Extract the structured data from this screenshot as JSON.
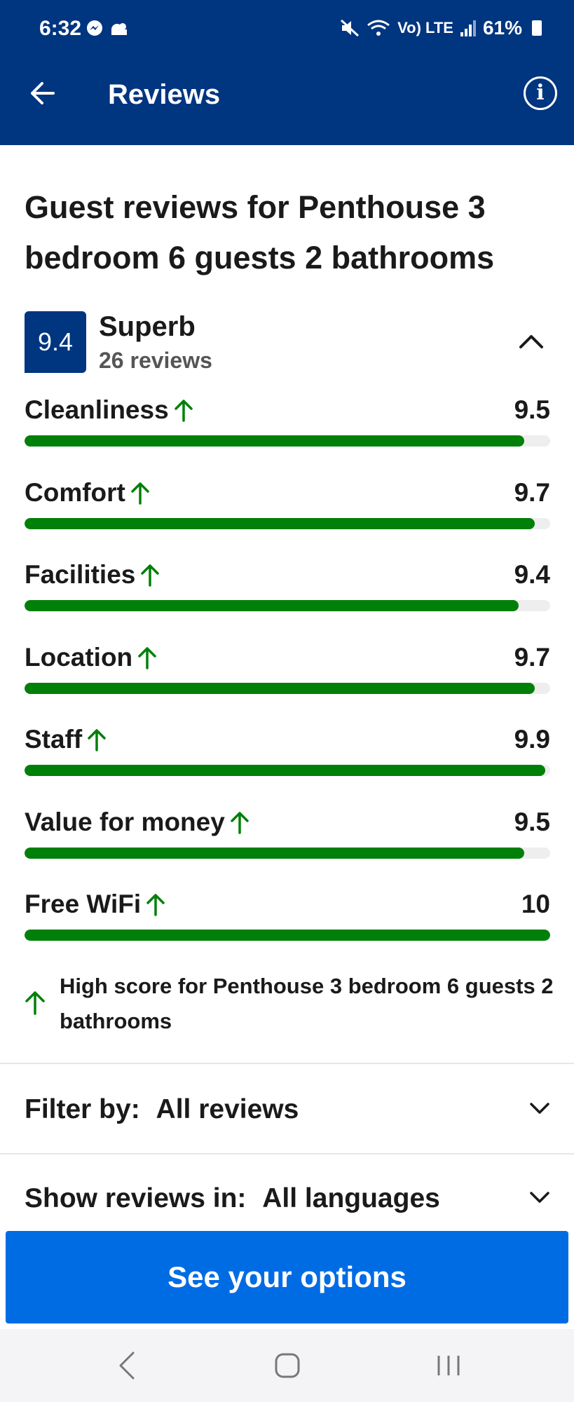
{
  "status_bar": {
    "time": "6:32",
    "battery": "61%",
    "network": "Vo) LTE"
  },
  "topbar": {
    "title": "Reviews"
  },
  "heading": "Guest reviews for Penthouse 3 bedroom 6 guests 2 bathrooms",
  "summary": {
    "score": "9.4",
    "rating_word": "Superb",
    "review_count": "26 reviews"
  },
  "categories": [
    {
      "label": "Cleanliness",
      "value": "9.5",
      "score": 9.5
    },
    {
      "label": "Comfort",
      "value": "9.7",
      "score": 9.7
    },
    {
      "label": "Facilities",
      "value": "9.4",
      "score": 9.4
    },
    {
      "label": "Location",
      "value": "9.7",
      "score": 9.7
    },
    {
      "label": "Staff",
      "value": "9.9",
      "score": 9.9
    },
    {
      "label": "Value for money",
      "value": "9.5",
      "score": 9.5
    },
    {
      "label": "Free WiFi",
      "value": "10",
      "score": 10
    }
  ],
  "high_score_note": "High score for Penthouse 3 bedroom 6 guests 2 bathrooms",
  "filter": {
    "label": "Filter by:",
    "value": "All reviews"
  },
  "language": {
    "label": "Show reviews in:",
    "value": "All languages"
  },
  "cta_label": "See your options",
  "colors": {
    "header": "#003580",
    "bar": "#008009",
    "cta": "#006ce4"
  }
}
